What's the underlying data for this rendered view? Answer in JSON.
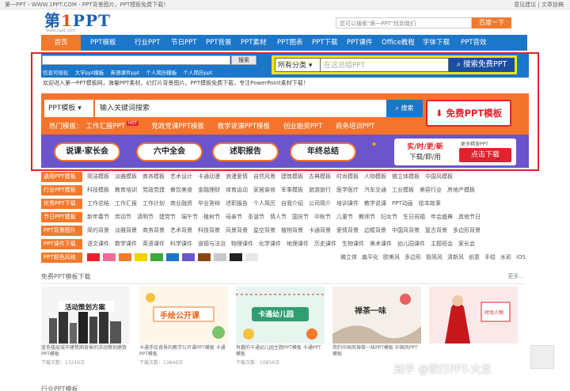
{
  "topbar": {
    "left": "第一PPT - WWW.1PPT.COM - PPT背景图片，PPT模板免费下载！",
    "right": "意见建议 | 文章投稿"
  },
  "logo": {
    "text_a": "第",
    "text_one": "1",
    "text_b": "PPT",
    "sub": "www.1ppt.com"
  },
  "top_search": {
    "placeholder": "您可以搜索\"第一PPT\"找到我们",
    "button": "百度一下"
  },
  "nav": {
    "home": "首页",
    "items": [
      "PPT模板",
      "行业PPT",
      "节日PPT",
      "PPT背景",
      "PPT素材",
      "PPT图表",
      "PPT下载",
      "PPT课件",
      "Office教程",
      "字体下载",
      "PPT音效"
    ]
  },
  "mini_search": {
    "button": "搜索",
    "links": [
      "信息可视化",
      "大学ppt模板",
      "英语课件ppt",
      "个人简历模板",
      "个人简历ppt"
    ]
  },
  "ysearch": {
    "select": "所有分类",
    "placeholder": "在这总结PPT",
    "button": "搜索免费PPT"
  },
  "welcome": "欢迎进入第一PPT模板网，海量PPT素材，幻灯片背景图片，PPT模板免费下载，专注PowerPoint素材下载！",
  "main_search": {
    "select": "PPT模板",
    "value": "输入关键词搜索",
    "button": "搜索"
  },
  "free_button": "免费PPT模板",
  "hot": {
    "label": "热门模板：",
    "items": [
      "工作汇报PPT",
      "党政党课PPT模板",
      "教学说课PPT模板",
      "创业融资PPT",
      "商务培训PPT"
    ],
    "tag": "HOT"
  },
  "pills": [
    "说课·家长会",
    "六中全会",
    "述职报告",
    "年终总结"
  ],
  "download": {
    "t1": "实/时/更/新",
    "t2": "下载/即/用",
    "small": "更多精美PPT",
    "button": "点击下载"
  },
  "categories": [
    {
      "label": "通用PPT模板",
      "items": [
        "简洁模板",
        "淡雅模板",
        "商务模板",
        "艺术设计",
        "卡通动漫",
        "浪漫爱情",
        "自然风景",
        "建筑模板",
        "古典模板",
        "时尚模板",
        "人物模板",
        "微立体模板",
        "中国风模板"
      ]
    },
    {
      "label": "行业PPT模板",
      "items": [
        "科技模板",
        "教育培训",
        "党政党建",
        "餐饮美食",
        "金融理财",
        "体育运动",
        "家居装修",
        "军事模板",
        "旅游旅行",
        "医学医疗",
        "汽车交通",
        "工业模板",
        "美容行业",
        "房地产模板"
      ]
    },
    {
      "label": "优秀PPT下载",
      "items": [
        "工作总结",
        "工作汇报",
        "工作计划",
        "商业融资",
        "毕业答辩",
        "述职报告",
        "个人简历",
        "自我介绍",
        "公司简介",
        "培训课件",
        "教学说课",
        "PPT动画",
        "绘本故事"
      ]
    },
    {
      "label": "节日PPT模板",
      "items": [
        "新年春节",
        "劳动节",
        "清明节",
        "建党节",
        "端午节",
        "植树节",
        "母亲节",
        "圣诞节",
        "情人节",
        "国庆节",
        "中秋节",
        "儿童节",
        "教师节",
        "妇女节",
        "生日祝福",
        "年会盛典",
        "其他节日"
      ]
    },
    {
      "label": "PPT背景图片",
      "items": [
        "简约背景",
        "淡雅背景",
        "商务背景",
        "艺术背景",
        "科技背景",
        "风景背景",
        "星空背景",
        "植物背景",
        "卡通背景",
        "爱情背景",
        "边框背景",
        "中国风背景",
        "复古背景",
        "多边形背景"
      ]
    },
    {
      "label": "PPT课件下载",
      "items": [
        "语文课件",
        "数学课件",
        "英语课件",
        "科学课件",
        "道德与法治",
        "物理课件",
        "化学课件",
        "地理课件",
        "历史课件",
        "生物课件",
        "美术课件",
        "幼儿园课件",
        "主题班会",
        "家长会"
      ]
    }
  ],
  "colors": {
    "label": "PPT颜色风格",
    "swatches": [
      "#e0232d",
      "#ef6c9b",
      "#f27a2c",
      "#f6d200",
      "#3ba93b",
      "#1c76c9",
      "#6c54cc",
      "#8b4513",
      "#c8c8c8",
      "#222222",
      "#e8e8e8"
    ],
    "styles": [
      "微立体",
      "扁平化",
      "欧美风",
      "多边形",
      "极简风",
      "清新风",
      "创意",
      "手绘",
      "水彩",
      "iOS"
    ]
  },
  "section": {
    "title": "免费PPT模板下载",
    "more": "更多..."
  },
  "cards": [
    {
      "thumb_text": "活动策划方案",
      "caption": "蓝色楼层城市建筑图背景的活动策划建筑PPT模板",
      "downloads": "下载次数：13216次"
    },
    {
      "thumb_text": "手绘公开课",
      "caption": "卡通手绘背景的教学公开课PPT模板 卡通PPT模板",
      "downloads": "下载次数：13846次"
    },
    {
      "thumb_text": "卡通幼儿园",
      "caption": "有趣的卡通幼儿园主题PPT模板 卡通PPT模板",
      "downloads": "下载次数：10856次"
    },
    {
      "thumb_text": "禅茶一味",
      "caption": "简约中国风禅茶一味PPT模板 中国风PPT模板",
      "downloads": ""
    },
    {
      "thumb_text": "时尚人物",
      "caption": "",
      "downloads": ""
    }
  ],
  "watermark": "知乎 @家打PPT-大龙",
  "bottom_head": "行业PPT模板"
}
